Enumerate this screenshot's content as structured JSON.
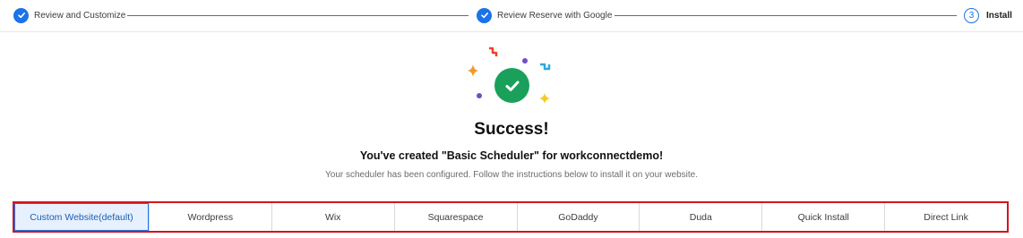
{
  "stepper": {
    "steps": [
      {
        "label": "Review and Customize",
        "state": "done"
      },
      {
        "label": "Review Reserve with Google",
        "state": "done"
      },
      {
        "label": "Install",
        "state": "current",
        "number": "3"
      }
    ]
  },
  "hero": {
    "title": "Success!",
    "subtitle": "You've created \"Basic Scheduler\" for workconnectdemo!",
    "description": "Your scheduler has been configured. Follow the instructions below to install it on your website.",
    "success_color": "#1aa05a"
  },
  "tabs": {
    "items": [
      {
        "label": "Custom Website(default)",
        "active": true
      },
      {
        "label": "Wordpress"
      },
      {
        "label": "Wix"
      },
      {
        "label": "Squarespace"
      },
      {
        "label": "GoDaddy"
      },
      {
        "label": "Duda"
      },
      {
        "label": "Quick Install"
      },
      {
        "label": "Direct Link"
      }
    ]
  },
  "colors": {
    "accent": "#1a73e8",
    "highlight_border": "#d4141c"
  }
}
